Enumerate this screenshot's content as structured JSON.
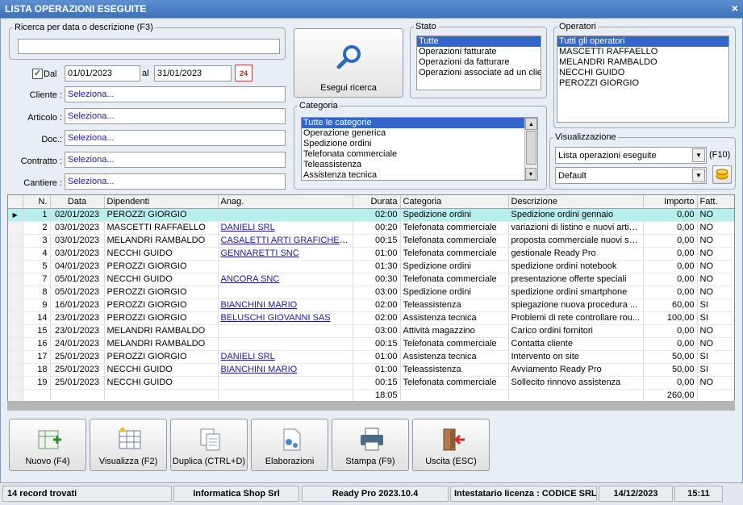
{
  "window": {
    "title": "LISTA OPERAZIONI ESEGUITE",
    "close": "×"
  },
  "search": {
    "legend": "Ricerca per data o descrizione (F3)",
    "value": ""
  },
  "date": {
    "checked": "✓",
    "dal_label": "Dal",
    "from": "01/01/2023",
    "al_label": "al",
    "to": "31/01/2023",
    "calendar_day": "24"
  },
  "filters": [
    {
      "label": "Cliente :",
      "value": "Seleziona..."
    },
    {
      "label": "Articolo :",
      "value": "Seleziona..."
    },
    {
      "label": "Doc.:",
      "value": "Seleziona..."
    },
    {
      "label": "Contratto :",
      "value": "Seleziona..."
    },
    {
      "label": "Cantiere :",
      "value": "Seleziona..."
    }
  ],
  "search_button": "Esegui ricerca",
  "stato": {
    "legend": "Stato",
    "items": [
      "Tutte",
      "Operazioni fatturate",
      "Operazioni da fatturare",
      "Operazioni associate ad un clien"
    ]
  },
  "operatori": {
    "legend": "Operatori",
    "items": [
      "Tutti gli operatori",
      "MASCETTI RAFFAELLO",
      "MELANDRI RAMBALDO",
      "NECCHI GUIDO",
      "PEROZZI GIORGIO"
    ]
  },
  "categoria": {
    "legend": "Categoria",
    "items": [
      "Tutte le categorie",
      "Operazione generica",
      "Spedizione ordini",
      "Telefonata commerciale",
      "Teleassistenza",
      "Assistenza tecnica"
    ]
  },
  "visualizzazione": {
    "legend": "Visualizzazione",
    "view": "Lista operazioni eseguite",
    "shortcut": "(F10)",
    "layout": "Default"
  },
  "grid": {
    "columns": [
      "N.",
      "Data",
      "Dipendenti",
      "Anag.",
      "Durata",
      "Categoria",
      "Descrizione",
      "Importo",
      "Fatt."
    ],
    "rows": [
      [
        "1",
        "02/01/2023",
        "PEROZZI GIORGIO",
        "",
        "02:00",
        "Spedizione ordini",
        "Spedizione ordini gennaio",
        "0,00",
        "NO"
      ],
      [
        "2",
        "03/01/2023",
        "MASCETTI RAFFAELLO",
        "DANIELI SRL",
        "00:20",
        "Telefonata commerciale",
        "variazioni di listino e nuovi articoli",
        "0,00",
        "NO"
      ],
      [
        "3",
        "03/01/2023",
        "MELANDRI RAMBALDO",
        "CASALETTI ARTI GRAFICHE SRL",
        "00:15",
        "Telefonata commerciale",
        "proposta commerciale nuovi se...",
        "0,00",
        "NO"
      ],
      [
        "4",
        "03/01/2023",
        "NECCHI GUIDO",
        "GENNARETTI SNC",
        "01:00",
        "Telefonata commerciale",
        "gestionale Ready Pro",
        "0,00",
        "NO"
      ],
      [
        "5",
        "04/01/2023",
        "PEROZZI GIORGIO",
        "",
        "01:30",
        "Spedizione ordini",
        "spedizione ordini notebook",
        "0,00",
        "NO"
      ],
      [
        "7",
        "05/01/2023",
        "NECCHI GUIDO",
        "ANCORA SNC",
        "00:30",
        "Telefonata commerciale",
        "presentazione offerte speciali",
        "0,00",
        "NO"
      ],
      [
        "8",
        "05/01/2023",
        "PEROZZI GIORGIO",
        "",
        "03:00",
        "Spedizione ordini",
        "spedizione ordini smartphone",
        "0,00",
        "NO"
      ],
      [
        "9",
        "16/01/2023",
        "PEROZZI GIORGIO",
        "BIANCHINI MARIO",
        "02:00",
        "Teleassistenza",
        "spiegazione nuova procedura ...",
        "60,00",
        "SI"
      ],
      [
        "14",
        "23/01/2023",
        "PEROZZI GIORGIO",
        "BELUSCHI GIOVANNI SAS",
        "02:00",
        "Assistenza tecnica",
        "Problemi di rete controllare rou...",
        "100,00",
        "SI"
      ],
      [
        "15",
        "23/01/2023",
        "MELANDRI RAMBALDO",
        "",
        "03:00",
        "Attività magazzino",
        "Carico ordini fornitori",
        "0,00",
        "NO"
      ],
      [
        "16",
        "24/01/2023",
        "MELANDRI RAMBALDO",
        "",
        "00:15",
        "Telefonata commerciale",
        "Contatta cliente",
        "0,00",
        "NO"
      ],
      [
        "17",
        "25/01/2023",
        "PEROZZI GIORGIO",
        "DANIELI SRL",
        "01:00",
        "Assistenza tecnica",
        "Intervento on site",
        "50,00",
        "SI"
      ],
      [
        "18",
        "25/01/2023",
        "NECCHI GUIDO",
        "BIANCHINI MARIO",
        "01:00",
        "Teleassistenza",
        "Avviamento Ready Pro",
        "50,00",
        "SI"
      ],
      [
        "19",
        "25/01/2023",
        "NECCHI GUIDO",
        "",
        "00:15",
        "Telefonata commerciale",
        "Sollecito rinnovo assistenza",
        "0,00",
        "NO"
      ]
    ],
    "totals": {
      "durata": "18:05",
      "importo": "260,00"
    }
  },
  "toolbar": [
    {
      "label": "Nuovo (F4)",
      "icon": "new-icon"
    },
    {
      "label": "Visualizza (F2)",
      "icon": "view-icon"
    },
    {
      "label": "Duplica (CTRL+D)",
      "icon": "duplicate-icon"
    },
    {
      "label": "Elaborazioni",
      "icon": "process-icon"
    },
    {
      "label": "Stampa (F9)",
      "icon": "print-icon"
    },
    {
      "label": "Uscita (ESC)",
      "icon": "exit-icon"
    }
  ],
  "status": {
    "records": "14 record trovati",
    "company": "Informatica Shop Srl",
    "version": "Ready Pro 2023.10.4",
    "license": "Intestatario licenza : CODICE SRL",
    "date": "14/12/2023",
    "time": "15:11"
  },
  "colors": {
    "titlebar": "#3c72b8",
    "selection": "#3366cc",
    "current_row": "#b7eeee",
    "link": "#1a1aa8"
  }
}
